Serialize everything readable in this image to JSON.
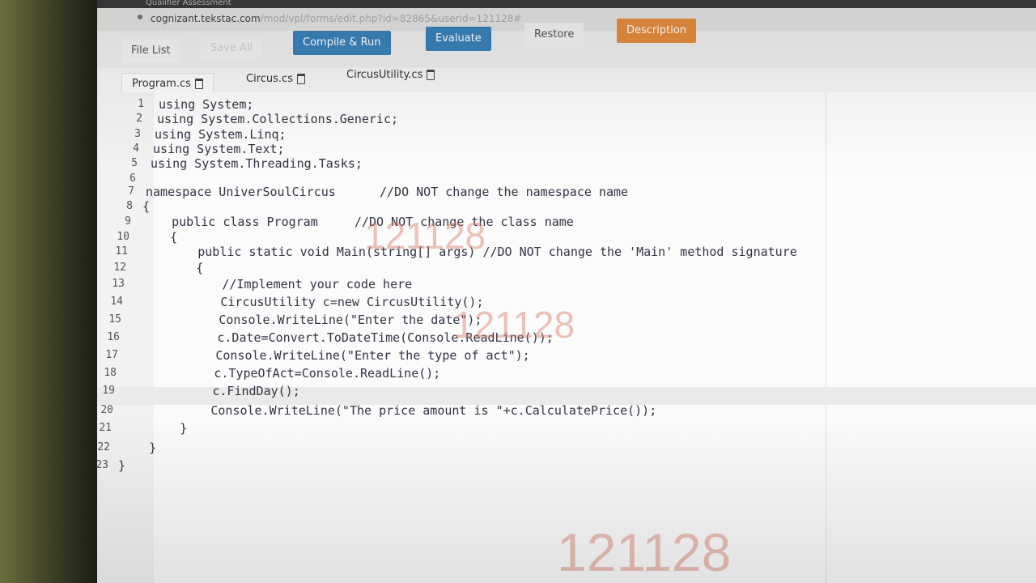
{
  "browser": {
    "tab_title": "Qualifier Assessment",
    "url_host": "cognizant.tekstac.com",
    "url_path": "/mod/vpl/forms/edit.php?id=82865&userid=121128#"
  },
  "toolbar": {
    "file_list": "File List",
    "save_all": "Save All",
    "compile_run": "Compile & Run",
    "evaluate": "Evaluate",
    "restore": "Restore",
    "description": "Description"
  },
  "file_tabs": [
    {
      "label": "Program.cs"
    },
    {
      "label": "Circus.cs"
    },
    {
      "label": "CircusUtility.cs"
    }
  ],
  "editor": {
    "lines": [
      {
        "num": "1",
        "code": "using System;"
      },
      {
        "num": "2",
        "code": "using System.Collections.Generic;"
      },
      {
        "num": "3",
        "code": "using System.Linq;"
      },
      {
        "num": "4",
        "code": "using System.Text;"
      },
      {
        "num": "5",
        "code": "using System.Threading.Tasks;"
      },
      {
        "num": "6",
        "code": ""
      },
      {
        "num": "7",
        "code": "namespace UniverSoulCircus      //DO NOT change the namespace name"
      },
      {
        "num": "8",
        "code": "{"
      },
      {
        "num": "9",
        "code": "    public class Program     //DO NOT change the class name"
      },
      {
        "num": "10",
        "code": "    {"
      },
      {
        "num": "11",
        "code": "        public static void Main(string[] args) //DO NOT change the 'Main' method signature"
      },
      {
        "num": "12",
        "code": "        {"
      },
      {
        "num": "13",
        "code": "            //Implement your code here"
      },
      {
        "num": "14",
        "code": "            CircusUtility c=new CircusUtility();"
      },
      {
        "num": "15",
        "code": "            Console.WriteLine(\"Enter the date\");"
      },
      {
        "num": "16",
        "code": "            c.Date=Convert.ToDateTime(Console.ReadLine());"
      },
      {
        "num": "17",
        "code": "            Console.WriteLine(\"Enter the type of act\");"
      },
      {
        "num": "18",
        "code": "            c.TypeOfAct=Console.ReadLine();"
      },
      {
        "num": "19",
        "code": "            c.FindDay();"
      },
      {
        "num": "20",
        "code": "            Console.WriteLine(\"The price amount is \"+c.CalculatePrice());"
      },
      {
        "num": "21",
        "code": "        }"
      },
      {
        "num": "22",
        "code": "    }"
      },
      {
        "num": "23",
        "code": "}"
      }
    ]
  },
  "watermark_text": "121128",
  "colors": {
    "accent_blue": "#3a81b8",
    "accent_orange": "#e48c3e",
    "watermark": "#d77864"
  }
}
